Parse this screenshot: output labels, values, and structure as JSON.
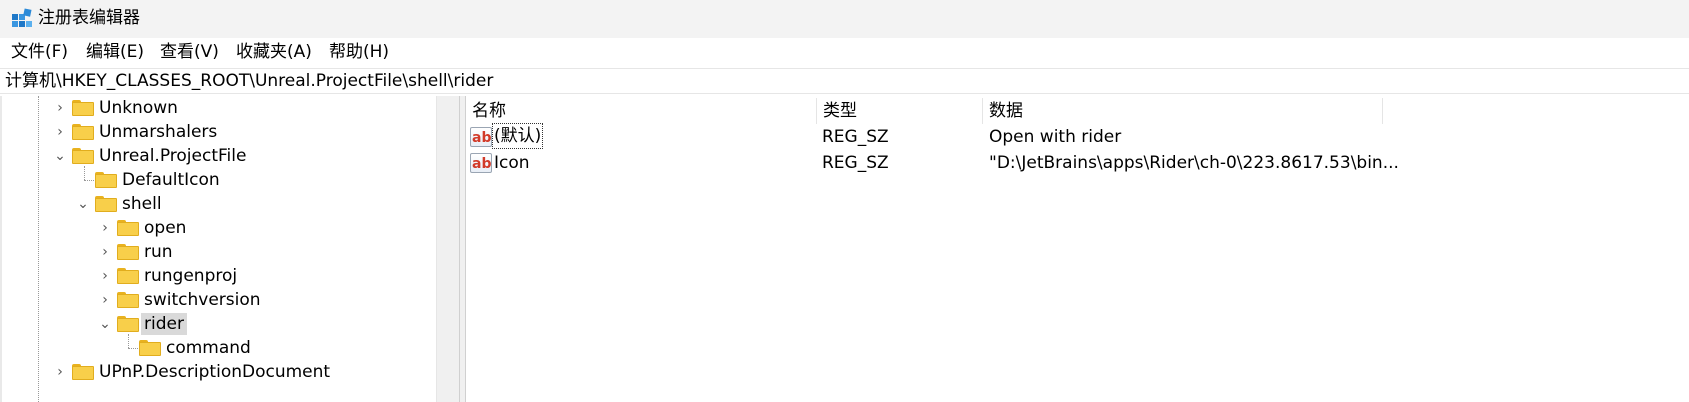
{
  "window": {
    "title": "注册表编辑器",
    "icon": "registry-editor-icon"
  },
  "menu": [
    {
      "label": "文件(F)"
    },
    {
      "label": "编辑(E)"
    },
    {
      "label": "查看(V)"
    },
    {
      "label": "收藏夹(A)"
    },
    {
      "label": "帮助(H)"
    }
  ],
  "address": {
    "path": "计算机\\HKEY_CLASSES_ROOT\\Unreal.ProjectFile\\shell\\rider"
  },
  "tree": {
    "items": [
      {
        "label": "Unknown",
        "expander": "collapsed"
      },
      {
        "label": "Unmarshalers",
        "expander": "collapsed"
      },
      {
        "label": "Unreal.ProjectFile",
        "expander": "expanded"
      },
      {
        "label": "DefaultIcon",
        "expander": "none"
      },
      {
        "label": "shell",
        "expander": "expanded"
      },
      {
        "label": "open",
        "expander": "collapsed"
      },
      {
        "label": "run",
        "expander": "collapsed"
      },
      {
        "label": "rungenproj",
        "expander": "collapsed"
      },
      {
        "label": "switchversion",
        "expander": "collapsed"
      },
      {
        "label": "rider",
        "expander": "expanded",
        "selected": true
      },
      {
        "label": "command",
        "expander": "none"
      },
      {
        "label": "UPnP.DescriptionDocument",
        "expander": "collapsed"
      }
    ]
  },
  "list": {
    "columns": [
      "名称",
      "类型",
      "数据"
    ],
    "rows": [
      {
        "name": "(默认)",
        "type": "REG_SZ",
        "data": "Open with rider",
        "icon": "string-value-icon"
      },
      {
        "name": "Icon",
        "type": "REG_SZ",
        "data": "\"D:\\JetBrains\\apps\\Rider\\ch-0\\223.8617.53\\bin...",
        "icon": "string-value-icon"
      }
    ]
  },
  "colors": {
    "folder": "#f8cf4a",
    "selection": "#d9d9d9",
    "titlebar": "#f3f3f3",
    "string_icon_text": "#d23b2a"
  }
}
